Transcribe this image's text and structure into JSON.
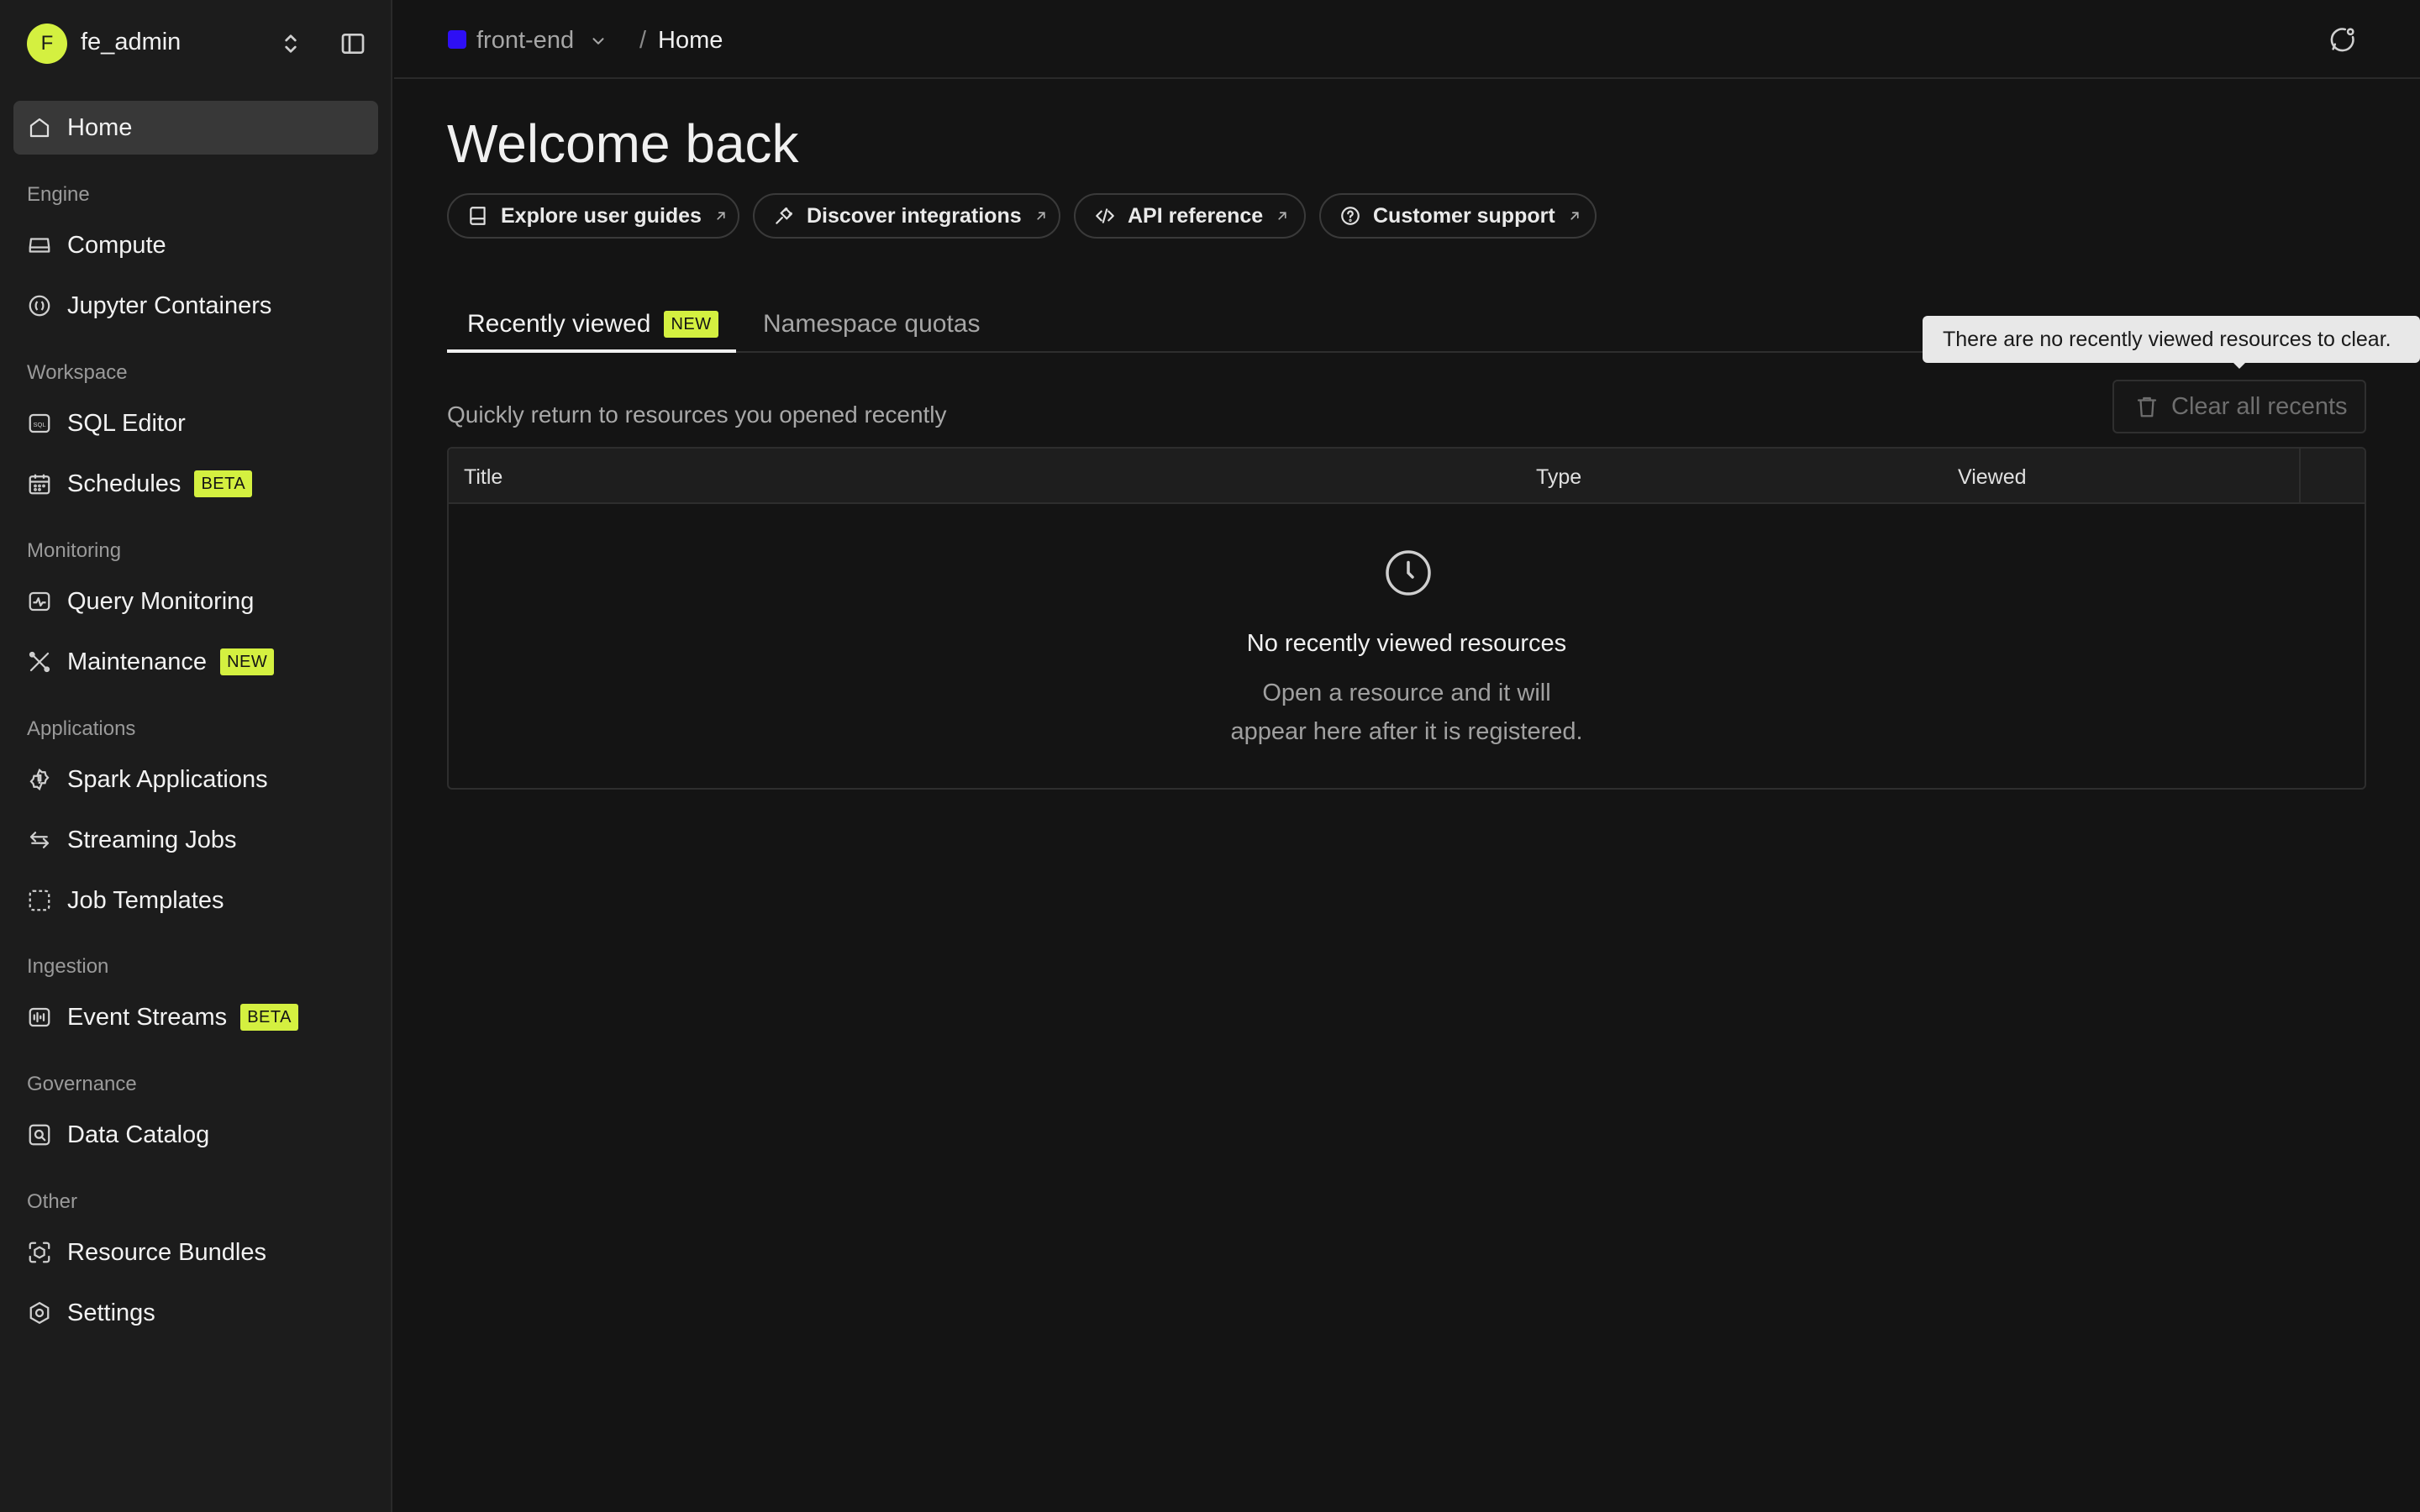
{
  "account": {
    "initial": "F",
    "name": "fe_admin"
  },
  "sidebar": {
    "home": "Home",
    "sections": [
      {
        "label": "Engine",
        "items": [
          {
            "label": "Compute"
          },
          {
            "label": "Jupyter Containers"
          }
        ]
      },
      {
        "label": "Workspace",
        "items": [
          {
            "label": "SQL Editor"
          },
          {
            "label": "Schedules",
            "badge": "BETA"
          }
        ]
      },
      {
        "label": "Monitoring",
        "items": [
          {
            "label": "Query Monitoring"
          },
          {
            "label": "Maintenance",
            "badge": "NEW"
          }
        ]
      },
      {
        "label": "Applications",
        "items": [
          {
            "label": "Spark Applications"
          },
          {
            "label": "Streaming Jobs"
          },
          {
            "label": "Job Templates"
          }
        ]
      },
      {
        "label": "Ingestion",
        "items": [
          {
            "label": "Event Streams",
            "badge": "BETA"
          }
        ]
      },
      {
        "label": "Governance",
        "items": [
          {
            "label": "Data Catalog"
          }
        ]
      },
      {
        "label": "Other",
        "items": [
          {
            "label": "Resource Bundles"
          },
          {
            "label": "Settings"
          }
        ]
      }
    ]
  },
  "topbar": {
    "project": "front-end",
    "separator": "/",
    "current": "Home",
    "project_color": "#2e0ff5"
  },
  "main": {
    "title": "Welcome back",
    "quick_links": [
      {
        "label": "Explore user guides"
      },
      {
        "label": "Discover integrations"
      },
      {
        "label": "API reference"
      },
      {
        "label": "Customer support"
      }
    ],
    "tabs": [
      {
        "label": "Recently viewed",
        "badge": "NEW"
      },
      {
        "label": "Namespace quotas"
      }
    ],
    "tooltip": "There are no recently viewed resources to clear.",
    "subtitle": "Quickly return to resources you opened recently",
    "clear_button": "Clear all recents",
    "table": {
      "columns": [
        "Title",
        "Type",
        "Viewed"
      ],
      "empty_title": "No recently viewed resources",
      "empty_line1": "Open a resource and it will",
      "empty_line2": "appear here after it is registered."
    }
  },
  "colors": {
    "accent": "#d4f040",
    "background": "#141414",
    "sidebar": "#1c1c1c"
  }
}
